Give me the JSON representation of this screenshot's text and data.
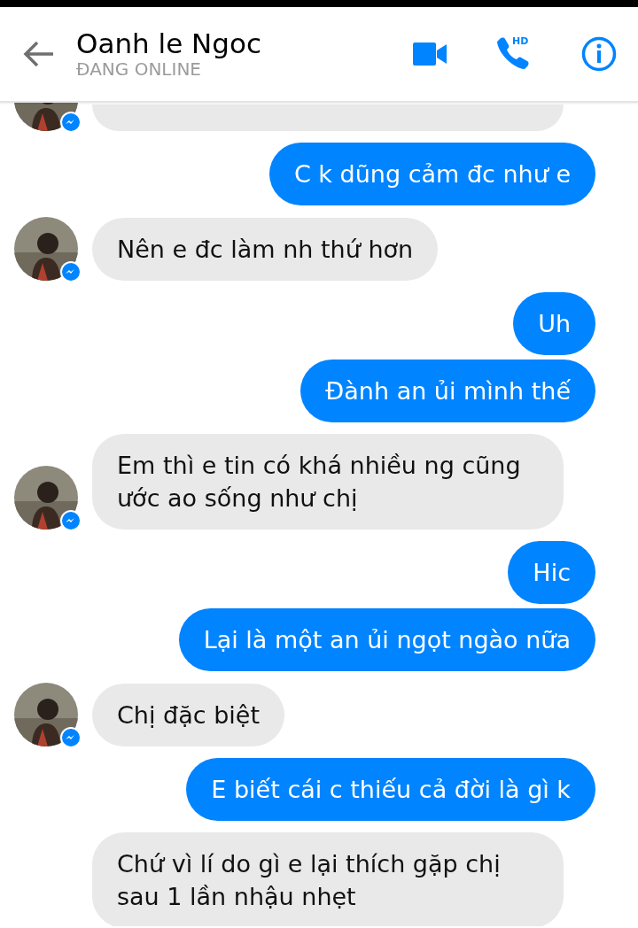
{
  "header": {
    "title": "Oanh le Ngoc",
    "status": "ĐANG ONLINE",
    "call_badge": "HD"
  },
  "messages": [
    {
      "outgoing": false,
      "kind": "clipped",
      "avatar": true
    },
    {
      "outgoing": true,
      "kind": "text",
      "text": "C k dũng cảm đc như e"
    },
    {
      "outgoing": false,
      "kind": "text",
      "text": "Nên e đc làm nh thứ hơn",
      "avatar": true
    },
    {
      "outgoing": true,
      "kind": "text",
      "text": "Uh"
    },
    {
      "outgoing": true,
      "kind": "text",
      "text": "Đành an ủi mình thế"
    },
    {
      "outgoing": false,
      "kind": "text",
      "text": "Em thì e tin có khá nhiều ng cũng ước ao sống như chị",
      "avatar": true
    },
    {
      "outgoing": true,
      "kind": "text",
      "text": "Hic"
    },
    {
      "outgoing": true,
      "kind": "text",
      "text": "Lại là một an ủi ngọt ngào nữa"
    },
    {
      "outgoing": false,
      "kind": "text",
      "text": "Chị đặc biệt",
      "avatar": true
    },
    {
      "outgoing": true,
      "kind": "text",
      "text": "E biết cái c thiếu cả đời là gì k"
    },
    {
      "outgoing": false,
      "kind": "text",
      "text": "Chứ vì lí do gì e lại thích gặp chị sau 1 lần nhậu nhẹt",
      "avatar": false
    }
  ]
}
